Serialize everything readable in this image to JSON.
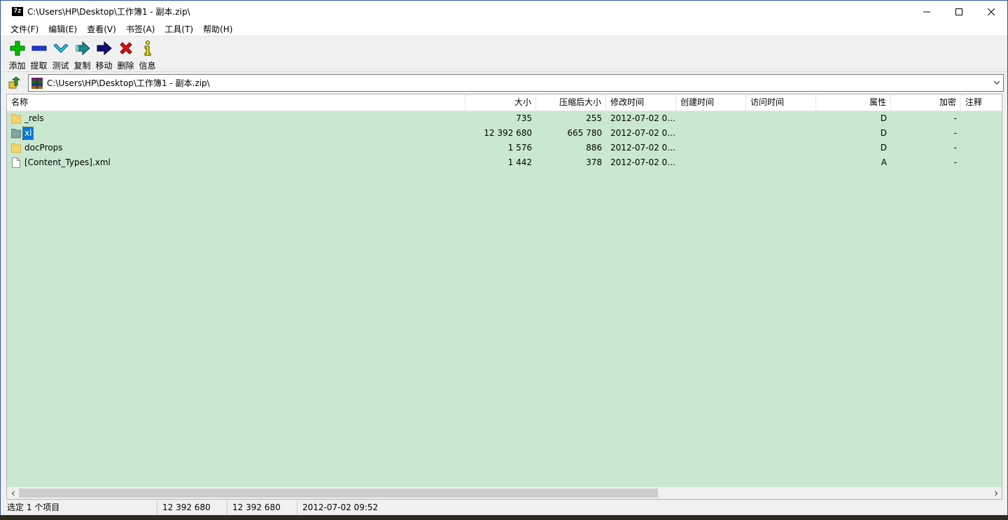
{
  "window": {
    "title": "C:\\Users\\HP\\Desktop\\工作簿1 - 副本.zip\\",
    "app_icon": "7z"
  },
  "menu": [
    "文件(F)",
    "编辑(E)",
    "查看(V)",
    "书签(A)",
    "工具(T)",
    "帮助(H)"
  ],
  "toolbar": [
    {
      "label": "添加",
      "icon": "plus-icon",
      "color": "#00c000"
    },
    {
      "label": "提取",
      "icon": "minus-icon",
      "color": "#1a3ad8"
    },
    {
      "label": "测试",
      "icon": "check-icon",
      "color": "#22c4d8"
    },
    {
      "label": "复制",
      "icon": "copy-arrow-icon",
      "color": "#1a8a8a"
    },
    {
      "label": "移动",
      "icon": "move-arrow-icon",
      "color": "#101070"
    },
    {
      "label": "删除",
      "icon": "delete-x-icon",
      "color": "#e01010"
    },
    {
      "label": "信息",
      "icon": "info-icon",
      "color": "#e8e000"
    }
  ],
  "address": {
    "path": "C:\\Users\\HP\\Desktop\\工作簿1 - 副本.zip\\"
  },
  "columns": [
    "名称",
    "大小",
    "压缩后大小",
    "修改时间",
    "创建时间",
    "访问时间",
    "属性",
    "加密",
    "注释"
  ],
  "files": [
    {
      "name": "_rels",
      "type": "folder",
      "size": "735",
      "packed": "255",
      "modified": "2012-07-02 0...",
      "created": "",
      "accessed": "",
      "attr": "D",
      "encrypted": "-",
      "comment": ""
    },
    {
      "name": "xl",
      "type": "folder",
      "size": "12 392 680",
      "packed": "665 780",
      "modified": "2012-07-02 0...",
      "created": "",
      "accessed": "",
      "attr": "D",
      "encrypted": "-",
      "comment": "",
      "selected": true
    },
    {
      "name": "docProps",
      "type": "folder",
      "size": "1 576",
      "packed": "886",
      "modified": "2012-07-02 0...",
      "created": "",
      "accessed": "",
      "attr": "D",
      "encrypted": "-",
      "comment": ""
    },
    {
      "name": "[Content_Types].xml",
      "type": "file",
      "size": "1 442",
      "packed": "378",
      "modified": "2012-07-02 0...",
      "created": "",
      "accessed": "",
      "attr": "A",
      "encrypted": "-",
      "comment": ""
    }
  ],
  "status": {
    "selection": "选定 1 个项目",
    "size": "12 392 680",
    "packed": "12 392 680",
    "modified": "2012-07-02 09:52"
  },
  "colors": {
    "list_background": "#c9e8cf",
    "selection": "#0078d7"
  }
}
